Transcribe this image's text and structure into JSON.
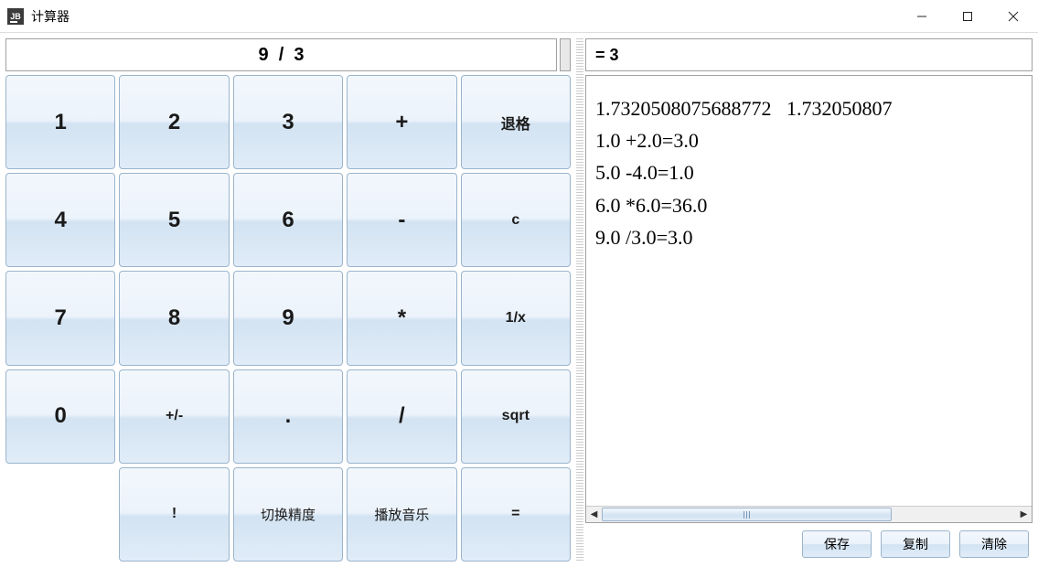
{
  "window": {
    "title": "计算器"
  },
  "expression": {
    "value": "9  /  3"
  },
  "result": {
    "value": "= 3"
  },
  "keys": {
    "r0c0": "1",
    "r0c1": "2",
    "r0c2": "3",
    "r0c3": "+",
    "r0c4": "退格",
    "r1c0": "4",
    "r1c1": "5",
    "r1c2": "6",
    "r1c3": "-",
    "r1c4": "c",
    "r2c0": "7",
    "r2c1": "8",
    "r2c2": "9",
    "r2c3": "*",
    "r2c4": "1/x",
    "r3c0": "0",
    "r3c1": "+/-",
    "r3c2": ".",
    "r3c3": "/",
    "r3c4": "sqrt",
    "r4c1": "!",
    "r4c2": "切换精度",
    "r4c3": "播放音乐",
    "r4c4": "="
  },
  "history": {
    "lines": [
      "1.7320508075688772   1.732050807",
      "1.0 +2.0=3.0",
      "5.0 -4.0=1.0",
      "6.0 *6.0=36.0",
      "9.0 /3.0=3.0"
    ]
  },
  "actions": {
    "save": "保存",
    "copy": "复制",
    "clear": "清除"
  }
}
